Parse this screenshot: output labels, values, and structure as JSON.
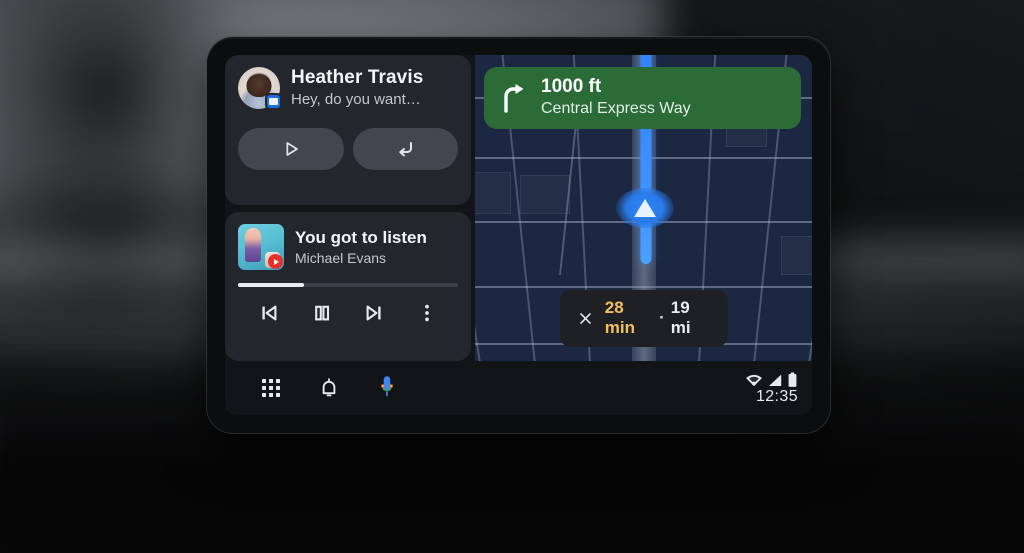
{
  "device": {
    "name": "car-head-unit-display"
  },
  "message_card": {
    "sender": "Heather Travis",
    "preview": "Hey, do you want…",
    "avatar_name": "contact-avatar",
    "app_badge_name": "messages-app-badge",
    "actions": [
      {
        "name": "play-message-button",
        "icon": "play-icon",
        "label": "Play"
      },
      {
        "name": "reply-message-button",
        "icon": "reply-icon",
        "label": "Reply"
      }
    ]
  },
  "media_card": {
    "track_title": "You got to listen",
    "artist": "Michael Evans",
    "album_art_name": "album-art",
    "source_badge": "youtube-music-badge",
    "progress_percent": 30,
    "controls": [
      {
        "name": "previous-track-button",
        "icon": "skip-previous-icon",
        "label": "Previous"
      },
      {
        "name": "pause-button",
        "icon": "pause-icon",
        "label": "Pause"
      },
      {
        "name": "next-track-button",
        "icon": "skip-next-icon",
        "label": "Next"
      },
      {
        "name": "media-overflow-button",
        "icon": "more-vert-icon",
        "label": "More options"
      }
    ]
  },
  "navigation": {
    "banner": {
      "distance": "1000 ft",
      "street": "Central Express Way",
      "maneuver_icon": "turn-right-icon",
      "background_color": "#2b6b38"
    },
    "eta": {
      "close_icon": "close-icon",
      "duration": "28 min",
      "separator": "·",
      "distance": "19 mi",
      "duration_color": "#f0c05a"
    },
    "map": {
      "marker_icon": "navigation-chevron-icon",
      "route_color": "#3c93ff",
      "background_color": "#1c2741"
    }
  },
  "bottom_bar": {
    "items": [
      {
        "name": "app-launcher-button",
        "icon": "apps-grid-icon",
        "label": "Apps"
      },
      {
        "name": "notifications-button",
        "icon": "bell-icon",
        "label": "Notifications"
      },
      {
        "name": "assistant-button",
        "icon": "google-assistant-mic-icon",
        "label": "Assistant"
      }
    ],
    "status": {
      "wifi_icon": "wifi-icon",
      "signal_icon": "cellular-signal-icon",
      "battery_icon": "battery-icon",
      "clock": "12:35"
    }
  }
}
